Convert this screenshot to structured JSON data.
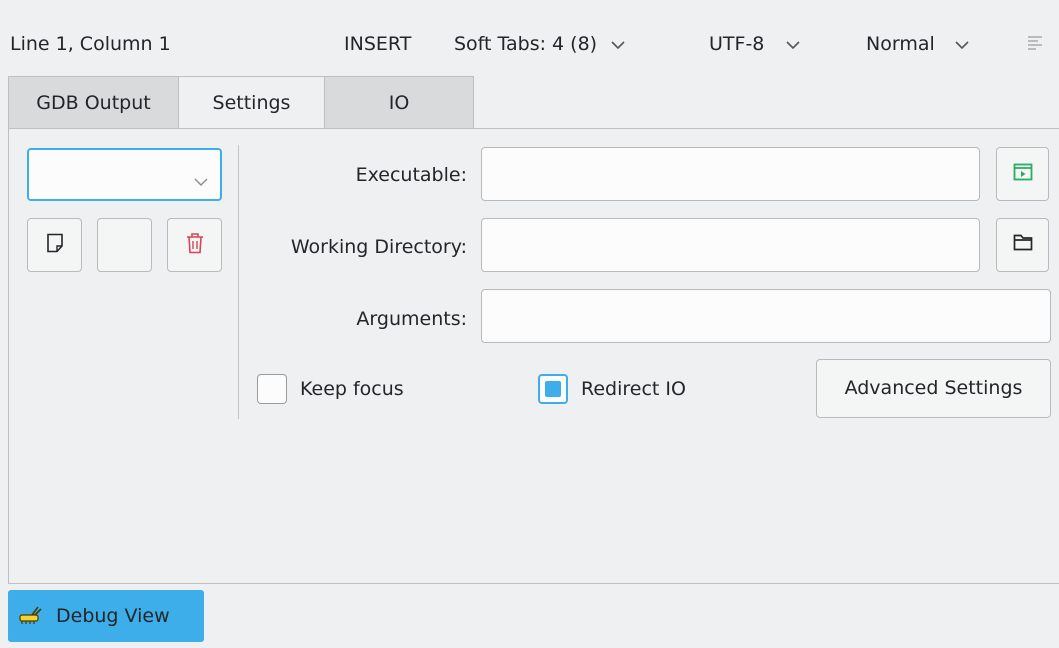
{
  "status_bar": {
    "position": "Line 1, Column 1",
    "mode": "INSERT",
    "indent": "Soft Tabs: 4 (8)",
    "encoding": "UTF-8",
    "input_mode": "Normal"
  },
  "tabs": [
    {
      "label": "GDB Output"
    },
    {
      "label": "Settings"
    },
    {
      "label": "IO"
    }
  ],
  "settings": {
    "profile_value": "",
    "executable_label": "Executable:",
    "executable_value": "",
    "workdir_label": "Working Directory:",
    "workdir_value": "",
    "arguments_label": "Arguments:",
    "arguments_value": "",
    "keep_focus_label": "Keep focus",
    "keep_focus_checked": false,
    "redirect_io_label": "Redirect IO",
    "redirect_io_checked": true,
    "advanced_label": "Advanced Settings"
  },
  "bottom": {
    "debug_view_label": "Debug View"
  },
  "colors": {
    "accent": "#3daee9",
    "background": "#eff0f1",
    "delete_red": "#da4453",
    "exec_green": "#27ae60"
  }
}
